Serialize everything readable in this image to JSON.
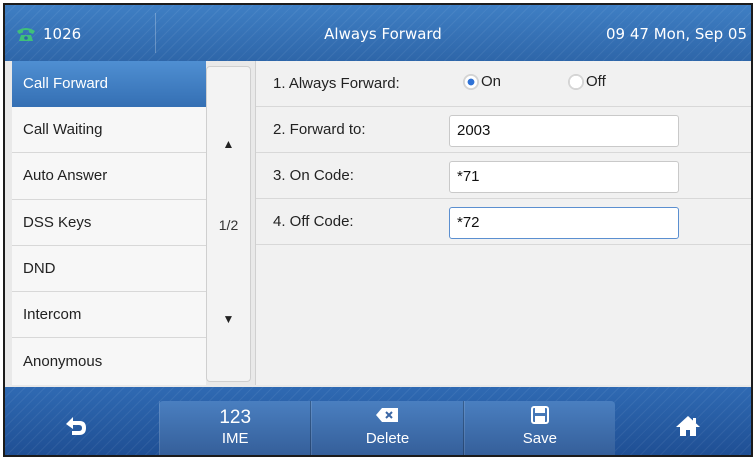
{
  "status_bar": {
    "extension": "1026",
    "title": "Always Forward",
    "datetime": "09 47 Mon, Sep 05"
  },
  "menu": {
    "items": [
      {
        "label": "Call Forward",
        "active": true
      },
      {
        "label": "Call Waiting",
        "active": false
      },
      {
        "label": "Auto Answer",
        "active": false
      },
      {
        "label": "DSS Keys",
        "active": false
      },
      {
        "label": "DND",
        "active": false
      },
      {
        "label": "Intercom",
        "active": false
      },
      {
        "label": "Anonymous",
        "active": false
      }
    ]
  },
  "pager": {
    "page_indicator": "1/2",
    "up_icon": "triangle-up-icon",
    "down_icon": "triangle-down-icon"
  },
  "form": {
    "always_forward": {
      "label": "1. Always Forward:",
      "on_label": "On",
      "off_label": "Off",
      "selected": "On"
    },
    "forward_to": {
      "label": "2. Forward to:",
      "value": "2003"
    },
    "on_code": {
      "label": "3. On Code:",
      "value": "*71"
    },
    "off_code": {
      "label": "4. Off Code:",
      "value": "*72"
    }
  },
  "softkeys": {
    "ime": {
      "top": "123",
      "label": "IME"
    },
    "delete": {
      "label": "Delete",
      "icon": "backspace-icon"
    },
    "save": {
      "label": "Save",
      "icon": "floppy-disk-icon"
    },
    "back_icon": "back-arrow-icon",
    "home_icon": "home-icon"
  },
  "colors": {
    "accent": "#3f7fc4",
    "active_item": "#3570b4",
    "radio_selected": "#2f72d6",
    "phone_icon": "#3fc07a"
  }
}
